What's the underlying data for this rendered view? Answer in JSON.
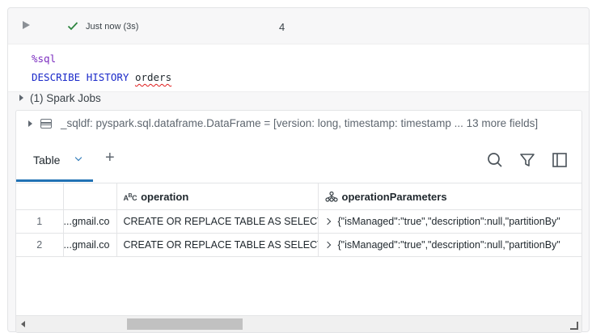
{
  "command": {
    "status_text": "Just now (3s)",
    "cell_number": "4"
  },
  "code": {
    "magic": "%sql",
    "keywords": "DESCRIBE HISTORY",
    "table_name": "orders"
  },
  "spark_jobs": {
    "label": "(1) Spark Jobs"
  },
  "dataframe": {
    "summary": "_sqldf:  pyspark.sql.dataframe.DataFrame = [version: long, timestamp: timestamp ... 13 more fields]"
  },
  "results": {
    "tab_label": "Table",
    "add_tab_symbol": "+",
    "columns": [
      {
        "name": "",
        "type_icon": ""
      },
      {
        "name": "operation",
        "type_icon": "string-type-icon"
      },
      {
        "name": "operationParameters",
        "type_icon": "struct-type-icon"
      }
    ],
    "rows": [
      {
        "index": "1",
        "user": "gmail.co...",
        "operation": "CREATE OR REPLACE TABLE AS SELECT",
        "parameters": "{\"isManaged\":\"true\",\"description\":null,\"partitionBy\""
      },
      {
        "index": "2",
        "user": "gmail.co...",
        "operation": "CREATE OR REPLACE TABLE AS SELECT",
        "parameters": "{\"isManaged\":\"true\",\"description\":null,\"partitionBy\""
      }
    ]
  },
  "colors": {
    "success": "#2e8540",
    "accent": "#2272b4",
    "magic_keyword": "#7a2bbf",
    "sql_keyword": "#1a29c9"
  }
}
